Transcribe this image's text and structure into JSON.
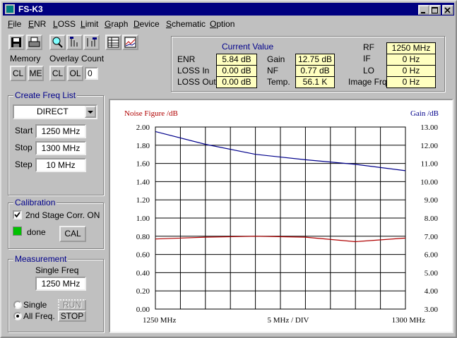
{
  "window": {
    "title": "FS-K3"
  },
  "menu": [
    {
      "label": "File",
      "u": "F",
      "rest": "ile"
    },
    {
      "label": "ENR",
      "u": "E",
      "rest": "NR"
    },
    {
      "label": "LOSS",
      "u": "L",
      "rest": "OSS"
    },
    {
      "label": "Limit",
      "u": "L",
      "rest": "imit"
    },
    {
      "label": "Graph",
      "u": "G",
      "rest": "raph"
    },
    {
      "label": "Device",
      "u": "D",
      "rest": "evice"
    },
    {
      "label": "Schematic",
      "u": "S",
      "rest": "chematic"
    },
    {
      "label": "Option",
      "u": "O",
      "rest": "ption"
    }
  ],
  "toolbar": {
    "memory_label": "Memory",
    "overlay_label": "Overlay",
    "count_label": "Count",
    "cl1": "CL",
    "me": "ME",
    "cl2": "CL",
    "ol": "OL",
    "count_value": "0"
  },
  "current_value": {
    "title": "Current Value",
    "enr_label": "ENR",
    "enr": "5.84 dB",
    "loss_in_label": "LOSS In",
    "loss_in": "0.00 dB",
    "loss_out_label": "LOSS Out",
    "loss_out": "0.00 dB",
    "gain_label": "Gain",
    "gain": "12.75 dB",
    "nf_label": "NF",
    "nf": "0.77 dB",
    "temp_label": "Temp.",
    "temp": "56.1 K",
    "rf_label": "RF",
    "rf": "1250 MHz",
    "if_label": "IF",
    "if": "0 Hz",
    "lo_label": "LO",
    "lo": "0 Hz",
    "image_label": "Image Frq.",
    "image": "0 Hz"
  },
  "freq_list": {
    "title": "Create Freq List",
    "mode": "DIRECT",
    "start_label": "Start",
    "start": "1250 MHz",
    "stop_label": "Stop",
    "stop": "1300 MHz",
    "step_label": "Step",
    "step": "10 MHz"
  },
  "calibration": {
    "title": "Calibration",
    "second_stage": "2nd Stage Corr. ON",
    "second_stage_checked": true,
    "status": "done",
    "status_color": "#00c000",
    "cal_button": "CAL"
  },
  "measurement": {
    "title": "Measurement",
    "single_freq_label": "Single Freq",
    "single_freq": "1250 MHz",
    "single_label": "Single",
    "all_label": "All Freq.",
    "selected": "All Freq.",
    "run_button": "RUN",
    "stop_button": "STOP"
  },
  "chart_data": {
    "type": "line",
    "left_axis_label": "Noise Figure /dB",
    "right_axis_label": "Gain /dB",
    "x_start_label": "1250 MHz",
    "x_mid_label": "5 MHz / DIV",
    "x_end_label": "1300 MHz",
    "xlim": [
      1250,
      1300
    ],
    "ylim_left": [
      0,
      2
    ],
    "ylim_right": [
      3,
      13
    ],
    "left_ticks": [
      "2.00",
      "1.80",
      "1.60",
      "1.40",
      "1.20",
      "1.00",
      "0.80",
      "0.60",
      "0.40",
      "0.20",
      "0.00"
    ],
    "right_ticks": [
      "13.00",
      "12.00",
      "11.00",
      "10.00",
      "9.00",
      "8.00",
      "7.00",
      "6.00",
      "5.00",
      "4.00",
      "3.00"
    ],
    "grid": true,
    "series": [
      {
        "name": "Noise Figure",
        "axis": "left",
        "color": "#b00000",
        "x": [
          1250,
          1260,
          1270,
          1280,
          1290,
          1300
        ],
        "values": [
          0.77,
          0.79,
          0.8,
          0.79,
          0.74,
          0.78
        ]
      },
      {
        "name": "Gain",
        "axis": "right",
        "color": "#00008b",
        "x": [
          1250,
          1260,
          1270,
          1280,
          1290,
          1300
        ],
        "values": [
          12.75,
          12.05,
          11.5,
          11.2,
          10.95,
          10.6
        ]
      }
    ]
  }
}
